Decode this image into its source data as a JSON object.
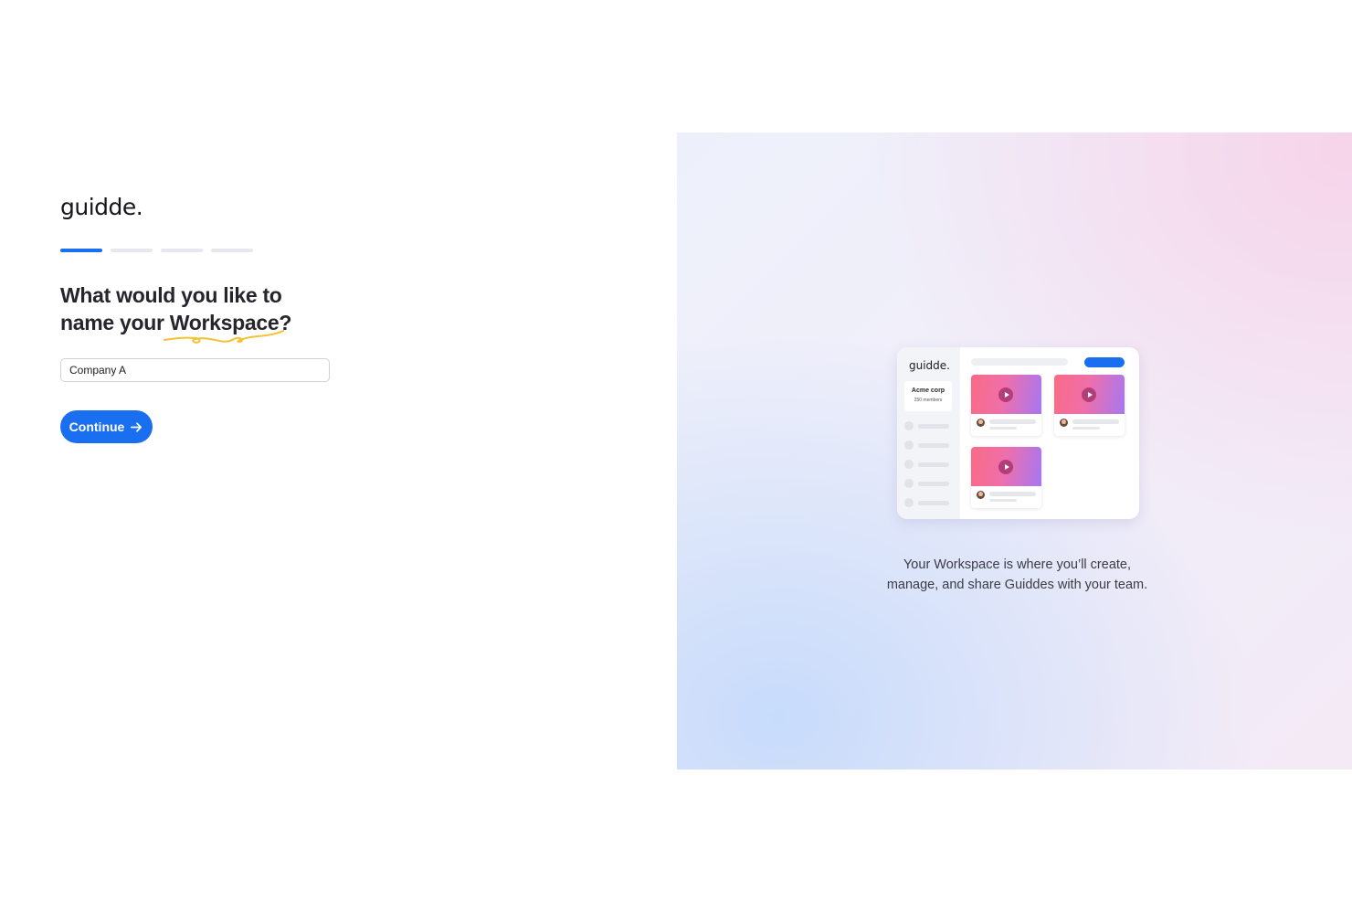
{
  "brand": {
    "logo_text": "guidde."
  },
  "progress": {
    "total_steps": 4,
    "current_step": 1,
    "active_color": "#1a6ff0",
    "inactive_color": "#e6e8ee"
  },
  "form": {
    "heading_line1": "What would you like to",
    "heading_line2_prefix": "name your ",
    "heading_highlight": "Workspace",
    "heading_suffix": "?",
    "workspace_name_value": "Company A",
    "continue_label": "Continue",
    "continue_icon": "arrow-right-icon",
    "accent_color": "#1a6ff0",
    "squiggle_color": "#f2c230"
  },
  "illustration": {
    "logo_text": "guidde.",
    "org_name": "Acme corp",
    "org_members": "250 members"
  },
  "caption": {
    "line1": "Your Workspace is where you’ll create,",
    "line2": "manage, and share Guiddes with your team."
  }
}
